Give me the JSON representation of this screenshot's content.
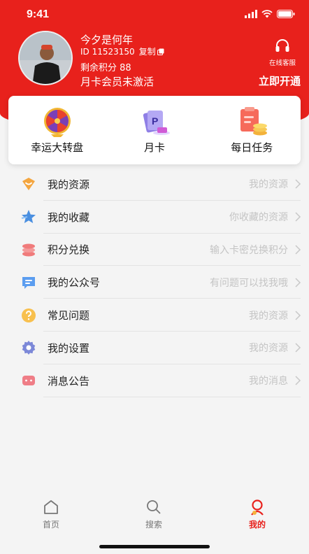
{
  "status_bar": {
    "time": "9:41"
  },
  "profile": {
    "username": "今夕是何年",
    "user_id": "ID 11523150",
    "copy_label": "复制",
    "points_label": "剩余积分 88",
    "member_status": "月卡会员未激活",
    "activate_label": "立即开通",
    "service_label": "在线客服"
  },
  "features": [
    {
      "label": "幸运大转盘",
      "icon": "lucky-wheel-icon"
    },
    {
      "label": "月卡",
      "icon": "month-card-icon"
    },
    {
      "label": "每日任务",
      "icon": "daily-task-icon"
    }
  ],
  "menu": [
    {
      "label": "我的资源",
      "hint": "我的资源",
      "icon": "heart-diamond-icon",
      "color": "#f4a640"
    },
    {
      "label": "我的收藏",
      "hint": "你收藏的资源",
      "icon": "star-icon",
      "color": "#4a8fe0"
    },
    {
      "label": "积分兑换",
      "hint": "输入卡密兑换积分",
      "icon": "coins-icon",
      "color": "#f07b7b"
    },
    {
      "label": "我的公众号",
      "hint": "有问题可以找我哦",
      "icon": "message-icon",
      "color": "#5b9df0"
    },
    {
      "label": "常见问题",
      "hint": "我的资源",
      "icon": "question-icon",
      "color": "#f8c04e"
    },
    {
      "label": "我的设置",
      "hint": "我的资源",
      "icon": "gear-icon",
      "color": "#7c88d8"
    },
    {
      "label": "消息公告",
      "hint": "我的消息",
      "icon": "notice-icon",
      "color": "#ef7d86"
    }
  ],
  "tabbar": {
    "items": [
      {
        "label": "首页",
        "icon": "home-icon"
      },
      {
        "label": "搜索",
        "icon": "search-icon"
      },
      {
        "label": "我的",
        "icon": "profile-icon"
      }
    ],
    "active_color": "#e8211c"
  },
  "colors": {
    "brand_red": "#e8211c",
    "background": "#f4f4f4"
  }
}
